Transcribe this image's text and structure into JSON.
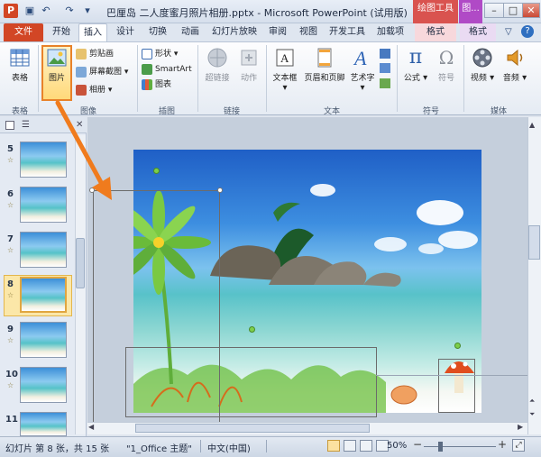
{
  "window": {
    "title": "巴厘岛 二人度蜜月照片相册.pptx - Microsoft PowerPoint (试用版)",
    "context_tab_headers": [
      "绘图工具",
      "图..."
    ],
    "accent": "#d24625",
    "help_icon": "?"
  },
  "tabs": [
    "文件",
    "开始",
    "插入",
    "设计",
    "切换",
    "动画",
    "幻灯片放映",
    "审阅",
    "视图",
    "开发工具",
    "加载项",
    "格式",
    "格式"
  ],
  "ribbon": {
    "groups": {
      "table": {
        "label": "表格",
        "buttons": [
          "表格"
        ]
      },
      "images": {
        "label": "图像",
        "big": "图片",
        "small": [
          "剪贴画",
          "屏幕截图",
          "相册"
        ]
      },
      "illustrations": {
        "label": "插图",
        "small": [
          "形状",
          "SmartArt",
          "图表"
        ]
      },
      "links": {
        "label": "链接",
        "buttons": [
          "超链接",
          "动作"
        ]
      },
      "text": {
        "label": "文本",
        "buttons": [
          "文本框",
          "页眉和页脚",
          "艺术字"
        ]
      },
      "symbols": {
        "label": "符号",
        "buttons": [
          "公式",
          "符号"
        ]
      },
      "media": {
        "label": "媒体",
        "buttons": [
          "视频",
          "音频"
        ]
      }
    }
  },
  "thumbnails": [
    "5",
    "6",
    "7",
    "8",
    "9",
    "10",
    "11"
  ],
  "selected_slide": "8",
  "statusbar": {
    "slide_info": "幻灯片 第 8 张，共 15 张",
    "theme": "\"1_Office 主题\"",
    "language": "中文(中国)",
    "zoom": "50%"
  }
}
